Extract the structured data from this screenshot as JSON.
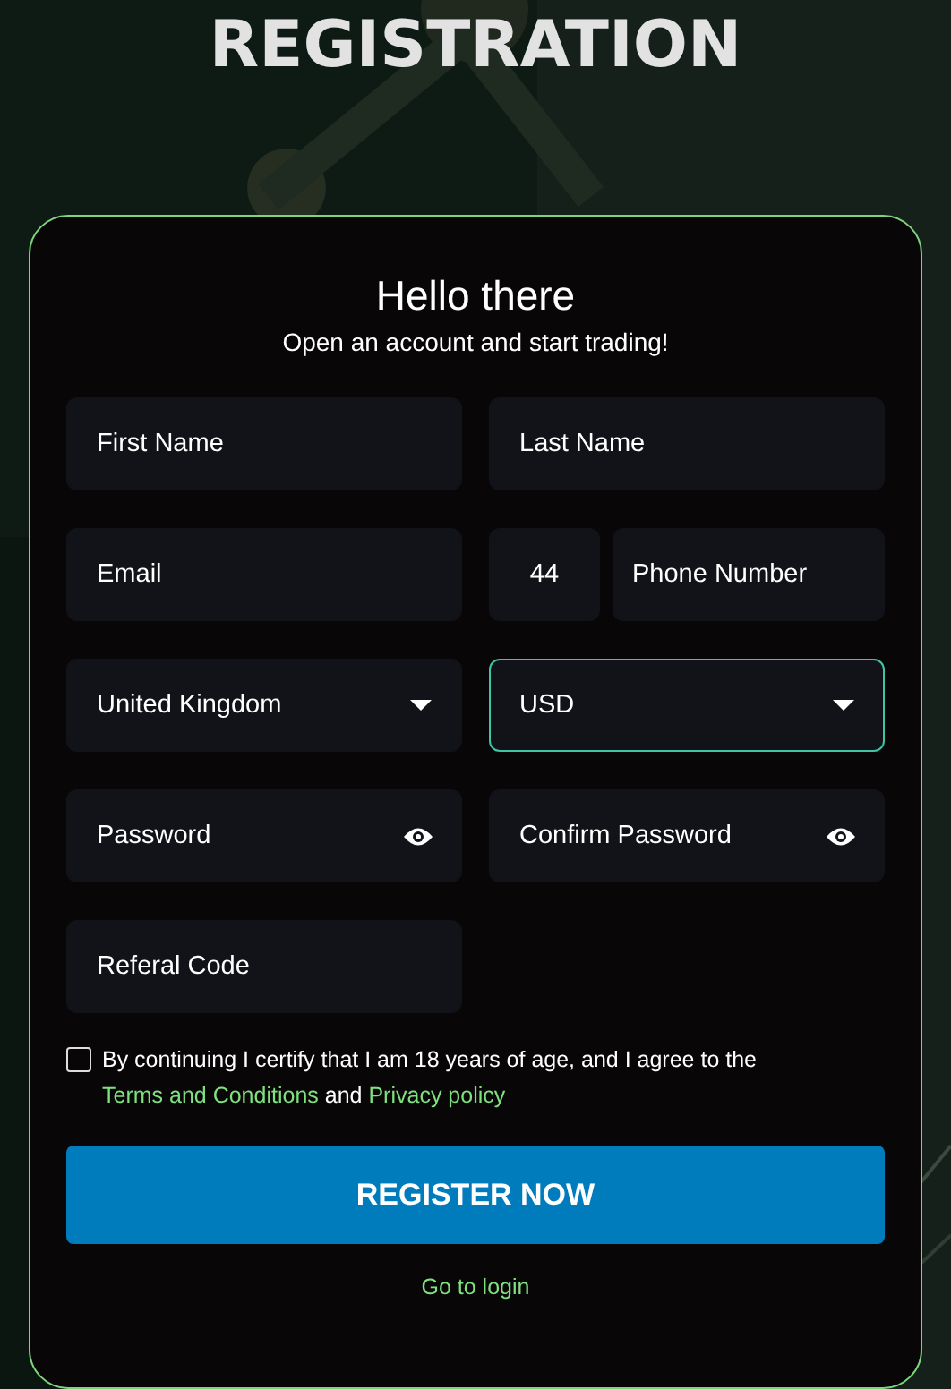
{
  "page_title": "REGISTRATION",
  "form": {
    "heading": "Hello there",
    "subheading": "Open an account and start trading!",
    "rows": [
      [
        {
          "kind": "text",
          "placeholder": "First Name",
          "focused": false
        },
        {
          "kind": "text",
          "placeholder": "Last Name",
          "focused": false
        }
      ],
      [
        {
          "kind": "text",
          "placeholder": "Email",
          "focused": false
        },
        {
          "kind": "phone",
          "code": "44",
          "placeholder": "Phone Number",
          "focused": false
        }
      ],
      [
        {
          "kind": "select",
          "value": "United Kingdom",
          "focused": false
        },
        {
          "kind": "select",
          "value": "USD",
          "focused": true
        }
      ],
      [
        {
          "kind": "password",
          "placeholder": "Password",
          "focused": false
        },
        {
          "kind": "password",
          "placeholder": "Confirm Password",
          "focused": false
        }
      ],
      [
        {
          "kind": "text",
          "placeholder": "Referal Code",
          "focused": false
        }
      ]
    ],
    "consent": {
      "checked": false,
      "text_before": "By continuing I certify that I am 18 years of age, and I agree to the",
      "terms_link": "Terms and Conditions",
      "text_middle": "and",
      "privacy_link": "Privacy policy"
    },
    "submit": "REGISTER NOW",
    "login_link": "Go to login"
  }
}
